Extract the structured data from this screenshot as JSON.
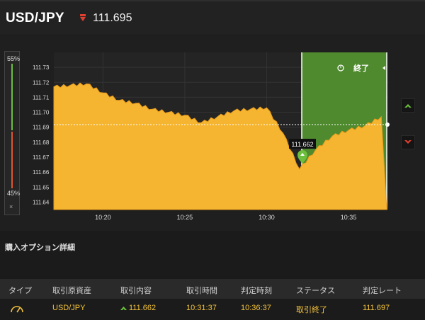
{
  "header": {
    "pair": "USD/JPY",
    "direction_icon": "down-arrow-icon",
    "price": "111.695"
  },
  "sentiment": {
    "up_pct": "55%",
    "down_pct": "45%",
    "close_label": "×"
  },
  "chart": {
    "y_ticks": [
      "111.73",
      "111.72",
      "111.71",
      "111.70",
      "111.69",
      "111.68",
      "111.67",
      "111.66",
      "111.65",
      "111.64"
    ],
    "x_ticks": [
      "10:20",
      "10:25",
      "10:30",
      "10:35"
    ],
    "entry_tooltip": "111.662",
    "expiry_label": "終了",
    "expiry_icon": "clock-icon",
    "fill_color": "#f5b531",
    "zone_color": "#4f8a2e",
    "up_button_icon": "up-arrow-icon",
    "down_button_icon": "down-arrow-icon"
  },
  "chart_data": {
    "type": "area",
    "x": [
      "10:17",
      "10:18",
      "10:19",
      "10:20",
      "10:21",
      "10:22",
      "10:23",
      "10:24",
      "10:25",
      "10:26",
      "10:27",
      "10:28",
      "10:29",
      "10:30",
      "10:31",
      "10:32",
      "10:33",
      "10:34",
      "10:35",
      "10:36",
      "10:37"
    ],
    "values": [
      111.717,
      111.718,
      111.719,
      111.713,
      111.708,
      111.706,
      111.702,
      111.7,
      111.698,
      111.693,
      111.697,
      111.701,
      111.702,
      111.703,
      111.686,
      111.662,
      111.675,
      111.684,
      111.688,
      111.691,
      111.697
    ],
    "ylim": [
      111.635,
      111.74
    ],
    "entry": {
      "x": "10:31:37",
      "y": 111.662
    },
    "current": 111.695
  },
  "detail": {
    "title": "購入オプション詳細",
    "columns": [
      "タイプ",
      "取引原資産",
      "取引内容",
      "取引時間",
      "判定時刻",
      "ステータス",
      "判定レート"
    ],
    "row": {
      "type_icon": "gauge-icon",
      "asset": "USD/JPY",
      "content": "111.662",
      "trade_time": "10:31:37",
      "judge_time": "10:36:37",
      "status": "取引終了",
      "rate": "111.697"
    }
  }
}
